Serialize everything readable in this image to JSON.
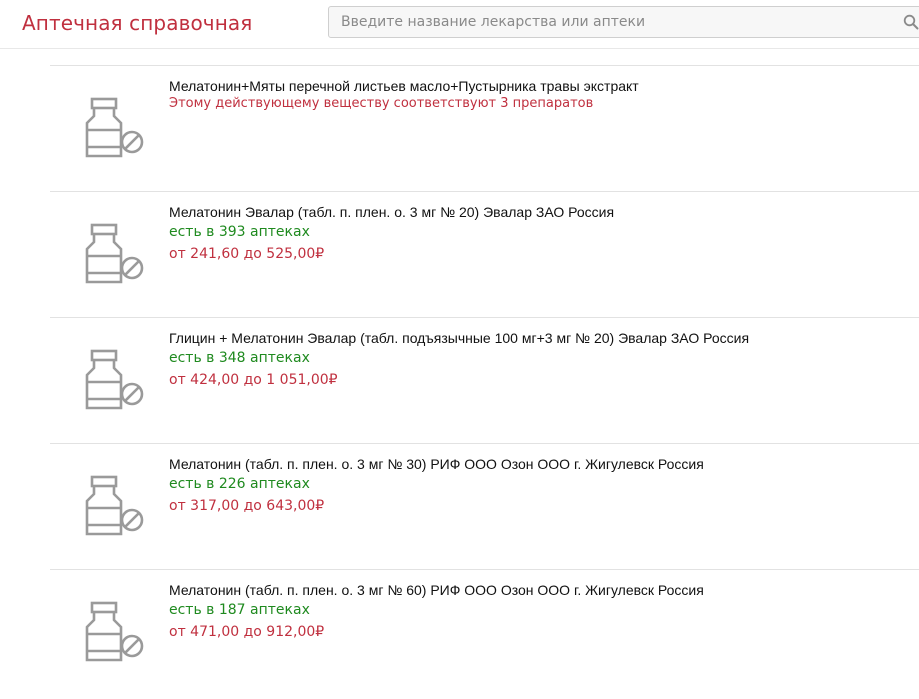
{
  "header": {
    "brand": "Аптечная справочная",
    "search_placeholder": "Введите название лекарства или аптеки",
    "search_value": ""
  },
  "items": [
    {
      "title": "Мелатонин+Мяты перечной листьев масло+Пустырника травы экстракт",
      "note": "Этому действующему веществу соответствуют 3 препаратов"
    },
    {
      "title": "Мелатонин Эвалар (табл. п. плен. о. 3 мг № 20) Эвалар ЗАО Россия",
      "availability": "есть в 393 аптеках",
      "price": "от 241,60 до 525,00₽"
    },
    {
      "title": "Глицин + Мелатонин Эвалар (табл. подъязычные 100 мг+3 мг № 20) Эвалар ЗАО Россия",
      "availability": "есть в 348 аптеках",
      "price": "от 424,00 до 1 051,00₽"
    },
    {
      "title": "Мелатонин (табл. п. плен. о. 3 мг № 30) РИФ ООО Озон ООО г. Жигулевск Россия",
      "availability": "есть в 226 аптеках",
      "price": "от 317,00 до 643,00₽"
    },
    {
      "title": "Мелатонин (табл. п. плен. о. 3 мг № 60) РИФ ООО Озон ООО г. Жигулевск Россия",
      "availability": "есть в 187 аптеках",
      "price": "от 471,00 до 912,00₽"
    }
  ],
  "icons": {
    "search": "search-icon",
    "item": "medicine-bottle-icon"
  },
  "colors": {
    "brand": "#c0303f",
    "availability": "#1f8a1f",
    "price": "#c0303f",
    "icon": "#9a9a9a"
  }
}
